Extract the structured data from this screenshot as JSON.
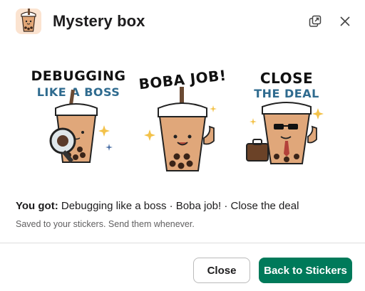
{
  "header": {
    "title": "Mystery box",
    "popout_icon": "popout-window-icon",
    "close_icon": "close-icon"
  },
  "stickers": [
    {
      "line1": "DEBUGGING",
      "line2": "LIKE A BOSS"
    },
    {
      "line1": "BOBA JOB!"
    },
    {
      "line1": "CLOSE",
      "line2": "THE DEAL"
    }
  ],
  "result": {
    "prefix": "You got:",
    "items": "Debugging like a boss · Boba job! · Close the deal",
    "note": "Saved to your stickers. Send them whenever."
  },
  "footer": {
    "close_label": "Close",
    "back_label": "Back to Stickers"
  },
  "colors": {
    "primary": "#007a5a",
    "boba_tea": "#e0a77a",
    "caption_blue": "#2f6b8f"
  }
}
